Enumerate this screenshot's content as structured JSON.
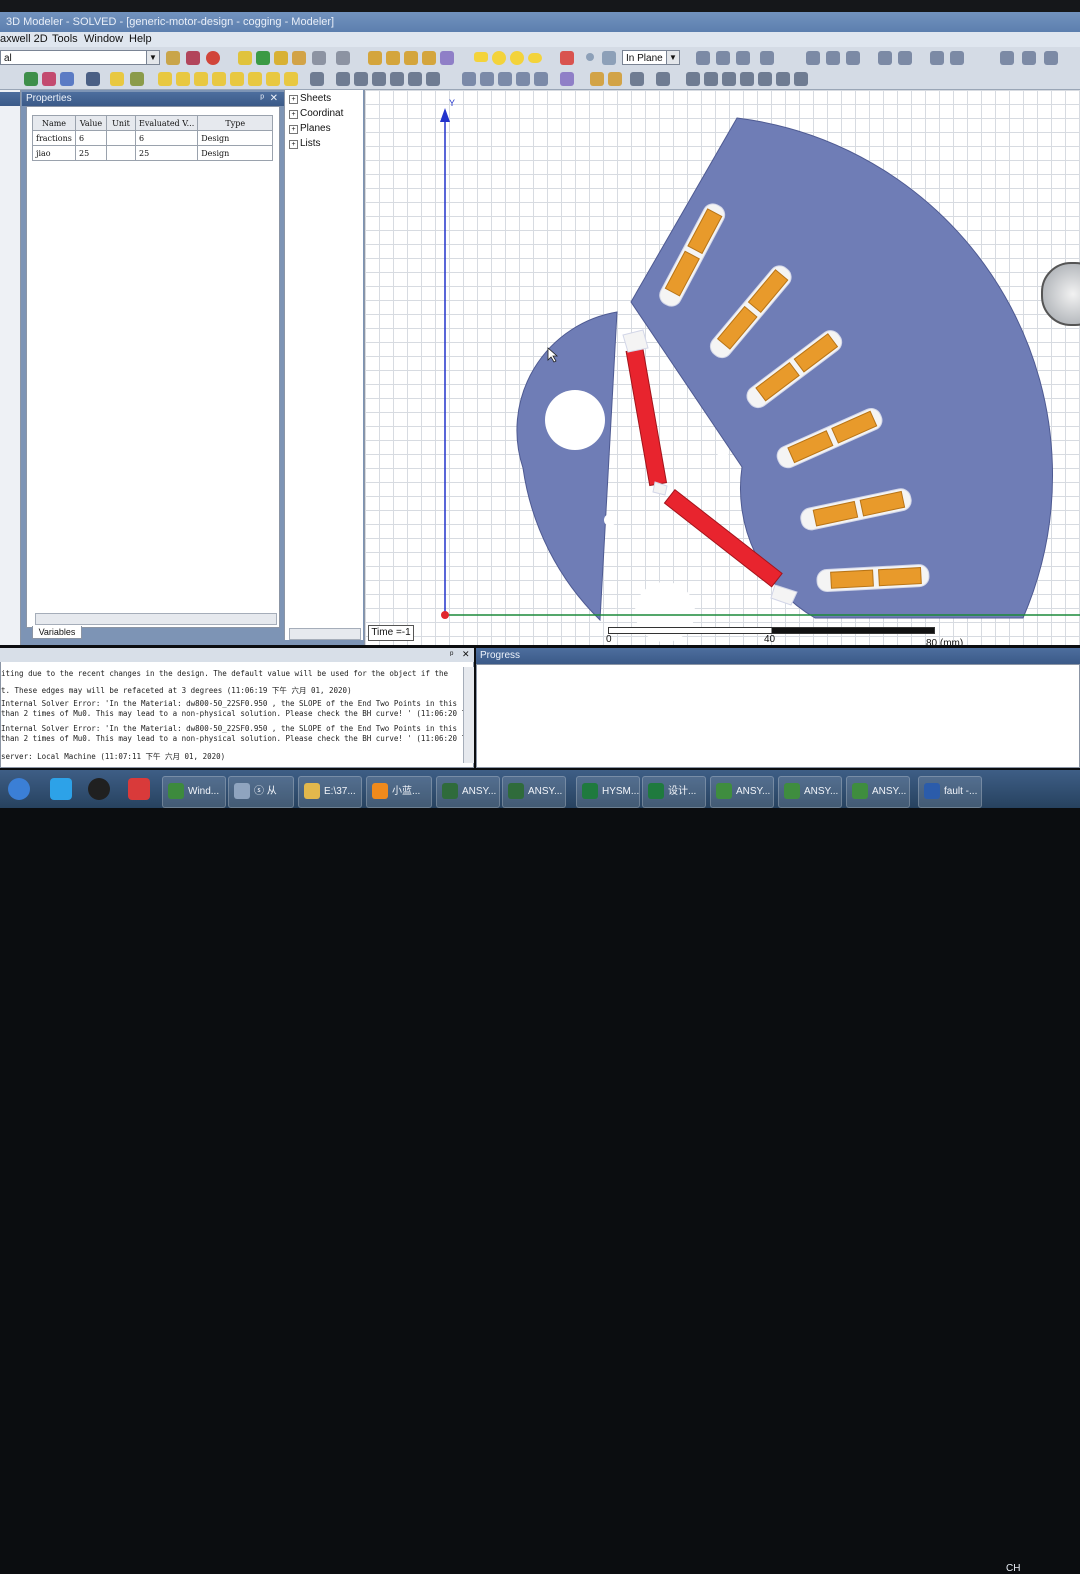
{
  "window": {
    "title": "3D Modeler - SOLVED - [generic-motor-design - cogging - Modeler]"
  },
  "menu": {
    "items": [
      "axwell 2D",
      "Tools",
      "Window",
      "Help"
    ]
  },
  "toolbar": {
    "combo_left_value": "al",
    "plane_value": "In Plane"
  },
  "properties": {
    "title": "Properties",
    "columns": [
      "Name",
      "Value",
      "Unit",
      "Evaluated V...",
      "Type"
    ],
    "rows": [
      [
        "fractions",
        "6",
        "",
        "6",
        "Design"
      ],
      [
        "jiao",
        "25",
        "",
        "25",
        "Design"
      ]
    ],
    "tab_label": "Variables"
  },
  "tree": {
    "items": [
      "Sheets",
      "Coordinat",
      "Planes",
      "Lists"
    ]
  },
  "viewport": {
    "axis_label": "Y",
    "time_label": "Time =-1",
    "scale": {
      "labels": [
        "0",
        "40",
        "80 (mm)"
      ]
    },
    "colors": {
      "lamination": "#6f7db6",
      "magnet": "#e8242e",
      "coil": "#e89a2b",
      "axis_y": "#2233cc",
      "axis_x": "#1c8a3a"
    }
  },
  "messages": {
    "lines": [
      "iting due to the recent changes in the design.  The default value will be used for the object if the",
      "t. These edges may will be refaceted at 3 degrees (11:06:19 下午  六月 01, 2020)",
      " Internal Solver Error: 'In the Material: dw800-50_22SF0.950 , the SLOPE of the End Two Points in this",
      "than 2 times of Mu0. This may lead to a non-physical solution. Please check the BH curve! ' (11:06:20 下",
      " Internal Solver Error: 'In the Material: dw800-50_22SF0.950 , the SLOPE of the End Two Points in this",
      "than 2 times of Mu0. This may lead to a non-physical solution. Please check the BH curve! ' (11:06:20 下",
      "server: Local Machine  (11:07:11 下午  六月 01, 2020)"
    ]
  },
  "progress": {
    "title": "Progress"
  },
  "taskbar": {
    "items": [
      {
        "label": "Wind...",
        "icon": "window-icon",
        "color": "#3d8a3d"
      },
      {
        "label": "ⓢ 从",
        "icon": "cloud-icon",
        "color": "#8fa4bf"
      },
      {
        "label": "E:\\37...",
        "icon": "folder-icon",
        "color": "#e3b84c"
      },
      {
        "label": "小蓝...",
        "icon": "browser-icon",
        "color": "#f08a1c"
      },
      {
        "label": "ANSY...",
        "icon": "ansys-icon",
        "color": "#2f6b3b"
      },
      {
        "label": "ANSY...",
        "icon": "ansys-icon",
        "color": "#2f6b3b"
      },
      {
        "label": "",
        "icon": "ansys-icon",
        "color": "#2f6b3b"
      },
      {
        "label": "HYSM...",
        "icon": "excel-icon",
        "color": "#1f7a3e"
      },
      {
        "label": "设计...",
        "icon": "excel-icon",
        "color": "#1f7a3e"
      },
      {
        "label": "ANSY...",
        "icon": "edt-icon",
        "color": "#3f8d3f"
      },
      {
        "label": "ANSY...",
        "icon": "edt-icon",
        "color": "#3f8d3f"
      },
      {
        "label": "ANSY...",
        "icon": "edt-icon",
        "color": "#3f8d3f"
      },
      {
        "label": "fault -...",
        "icon": "word-icon",
        "color": "#2b5cab"
      }
    ],
    "tray_text": "CH"
  }
}
